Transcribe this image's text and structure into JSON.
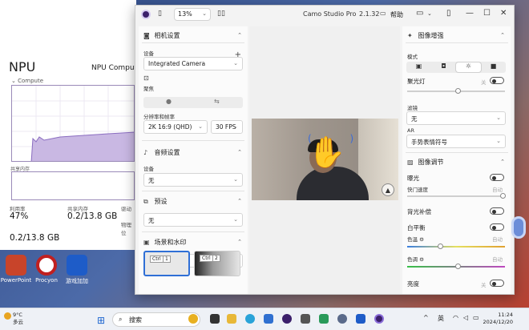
{
  "taskmgr": {
    "title": "NPU",
    "device_name": "NPU Compute",
    "compute_label": "Compute",
    "shared_memory_label": "共享内存",
    "utilization_label": "利用率",
    "utilization_value": "47%",
    "shared_label": "共享内存",
    "shared_value": "0.2/13.8 GB",
    "driver_label": "驱动",
    "physical_label": "物理位",
    "shared_value_2": "0.2/13.8 GB"
  },
  "desktop_icons": [
    "PowerPoint",
    "Procyon",
    "游戏加加"
  ],
  "camo": {
    "zoom": "13%",
    "app_title": "Camo Studio Pro",
    "version": "2.1.32",
    "help": "帮助",
    "camera_settings": {
      "title": "相机设置",
      "device_label": "设备",
      "device_value": "Integrated Camera",
      "lens_label": "聚焦",
      "resolution_label": "分辨率和帧率",
      "resolution_value": "2K 16:9 (QHD)",
      "fps_value": "30 FPS"
    },
    "audio_settings": {
      "title": "音频设置",
      "device_label": "设备",
      "device_value": "无"
    },
    "presets": {
      "title": "预设",
      "value": "无"
    },
    "scenes": {
      "title": "场景和水印",
      "value": "所有",
      "items": [
        {
          "chip": "Ctrl",
          "num": "1"
        },
        {
          "chip": "Ctrl",
          "num": "2"
        }
      ]
    },
    "enhance": {
      "title": "图像增强",
      "mode_label": "模式",
      "spotlight_label": "聚光灯",
      "spotlight_state": "关",
      "filter_label": "滤镜",
      "filter_value": "无",
      "ar_label": "AR",
      "ar_value": "手势表情符号"
    },
    "adjust": {
      "title": "图像调节",
      "exposure_label": "曝光",
      "shutter_label": "快门速度",
      "shutter_auto": "自动",
      "backlight_label": "背光补偿",
      "wb_label": "白平衡",
      "temp_label": "色温",
      "temp_auto": "自动",
      "tint_label": "色调",
      "tint_auto": "自动",
      "brightness_label": "亮度",
      "brightness_state": "关"
    }
  },
  "taskbar": {
    "weather_temp": "9°C",
    "weather_desc": "多云",
    "search_placeholder": "搜索",
    "ime": "英",
    "time": "11:24",
    "date": "2024/12/20"
  }
}
